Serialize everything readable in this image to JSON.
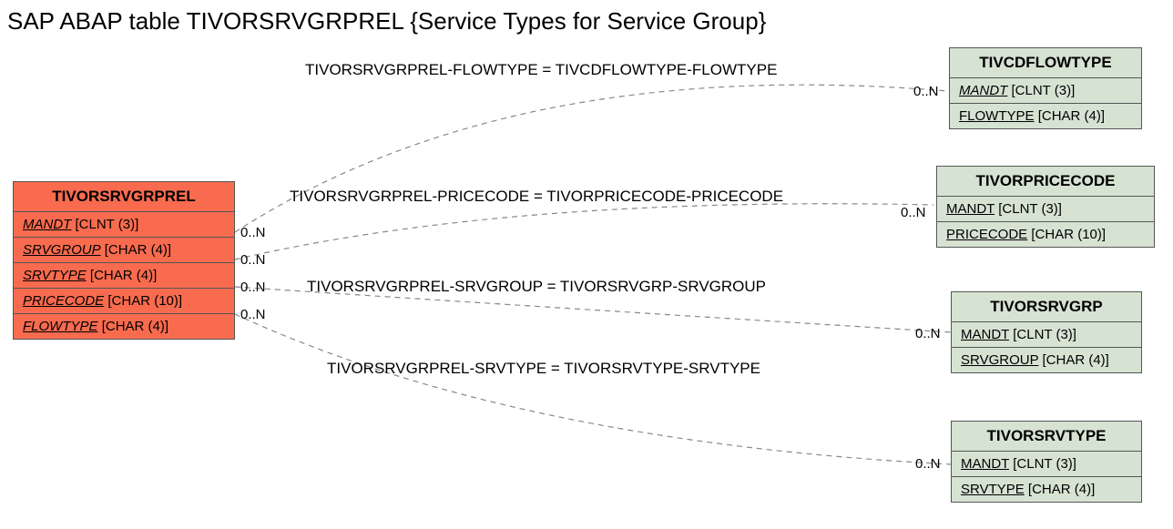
{
  "title": "SAP ABAP table TIVORSRVGRPREL {Service Types for Service Group}",
  "primary_entity": {
    "name": "TIVORSRVGRPREL",
    "fields": [
      {
        "name": "MANDT",
        "type": "[CLNT (3)]"
      },
      {
        "name": "SRVGROUP",
        "type": "[CHAR (4)]"
      },
      {
        "name": "SRVTYPE",
        "type": "[CHAR (4)]"
      },
      {
        "name": "PRICECODE",
        "type": "[CHAR (10)]"
      },
      {
        "name": "FLOWTYPE",
        "type": "[CHAR (4)]"
      }
    ]
  },
  "related_entities": [
    {
      "name": "TIVCDFLOWTYPE",
      "fields": [
        {
          "name": "MANDT",
          "type": "[CLNT (3)]",
          "italic": true
        },
        {
          "name": "FLOWTYPE",
          "type": "[CHAR (4)]",
          "italic": false
        }
      ]
    },
    {
      "name": "TIVORPRICECODE",
      "fields": [
        {
          "name": "MANDT",
          "type": "[CLNT (3)]",
          "italic": false
        },
        {
          "name": "PRICECODE",
          "type": "[CHAR (10)]",
          "italic": false
        }
      ]
    },
    {
      "name": "TIVORSRVGRP",
      "fields": [
        {
          "name": "MANDT",
          "type": "[CLNT (3)]",
          "italic": false
        },
        {
          "name": "SRVGROUP",
          "type": "[CHAR (4)]",
          "italic": false
        }
      ]
    },
    {
      "name": "TIVORSRVTYPE",
      "fields": [
        {
          "name": "MANDT",
          "type": "[CLNT (3)]",
          "italic": false
        },
        {
          "name": "SRVTYPE",
          "type": "[CHAR (4)]",
          "italic": false
        }
      ]
    }
  ],
  "relations": [
    {
      "label": "TIVORSRVGRPREL-FLOWTYPE = TIVCDFLOWTYPE-FLOWTYPE",
      "card_left": "0..N",
      "card_right": "0..N"
    },
    {
      "label": "TIVORSRVGRPREL-PRICECODE = TIVORPRICECODE-PRICECODE",
      "card_left": "0..N",
      "card_right": "0..N"
    },
    {
      "label": "TIVORSRVGRPREL-SRVGROUP = TIVORSRVGRP-SRVGROUP",
      "card_left": "0..N",
      "card_right": "0..N"
    },
    {
      "label": "TIVORSRVGRPREL-SRVTYPE = TIVORSRVTYPE-SRVTYPE",
      "card_left": "0..N",
      "card_right": "0..N"
    }
  ]
}
